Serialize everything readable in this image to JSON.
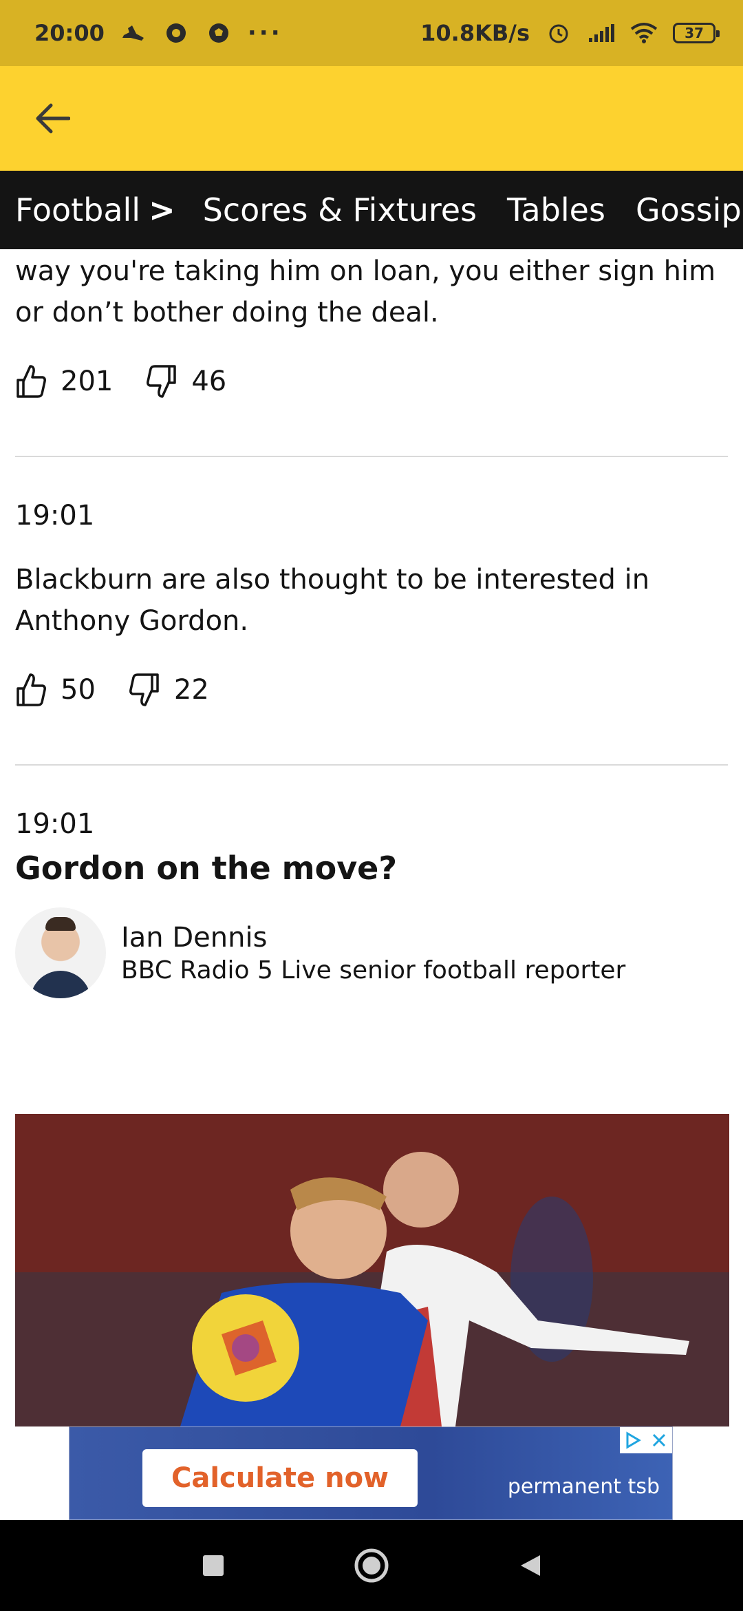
{
  "status_bar": {
    "time": "20:00",
    "net_speed": "10.8KB/s",
    "battery": "37",
    "icons": [
      "shoe-icon",
      "chrome-icon",
      "football-icon",
      "more-dots-icon",
      "alarm-icon",
      "signal-icon",
      "wifi-icon",
      "battery-icon"
    ]
  },
  "header": {
    "back_icon": "arrow-left-icon"
  },
  "nav": {
    "items": [
      {
        "label": "Football"
      },
      {
        "label": "Scores & Fixtures"
      },
      {
        "label": "Tables"
      },
      {
        "label": "Gossip"
      }
    ],
    "chevron": ">"
  },
  "posts": [
    {
      "text": "way you're taking him on loan, you either sign him or don’t bother doing the deal.",
      "likes": "201",
      "dislikes": "46"
    },
    {
      "time": "19:01",
      "text": "Blackburn are also thought to be interested in Anthony Gordon.",
      "likes": "50",
      "dislikes": "22"
    },
    {
      "time": "19:01",
      "headline": "Gordon on the move?",
      "author_name": "Ian Dennis",
      "author_role": "BBC Radio 5 Live senior football reporter"
    }
  ],
  "ad": {
    "button_label": "Calculate now",
    "brand": "permanent tsb",
    "button_color": "#e2622a"
  },
  "colors": {
    "status_bar": "#d8b224",
    "header": "#fdd22f",
    "nav": "#141414"
  }
}
